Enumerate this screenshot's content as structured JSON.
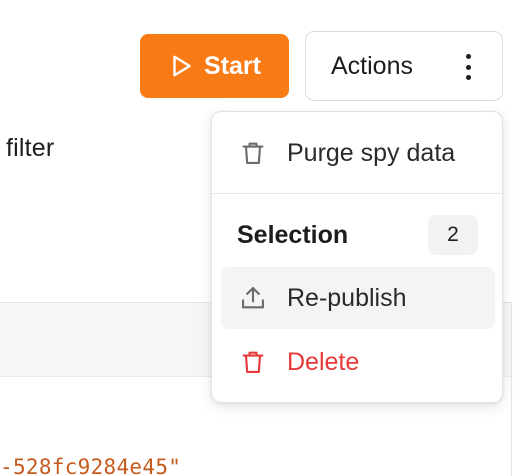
{
  "toolbar": {
    "start_label": "Start",
    "actions_label": "Actions",
    "start_color": "#f97b16"
  },
  "background": {
    "filter_label": "filter",
    "code_fragment": "-528fc9284e45\""
  },
  "menu": {
    "purge_label": "Purge spy data",
    "selection_title": "Selection",
    "selection_count": "2",
    "republish_label": "Re-publish",
    "delete_label": "Delete",
    "delete_color": "#e5393a",
    "icons": {
      "purge": "trash-icon",
      "republish": "upload-icon",
      "delete": "trash-icon"
    }
  }
}
